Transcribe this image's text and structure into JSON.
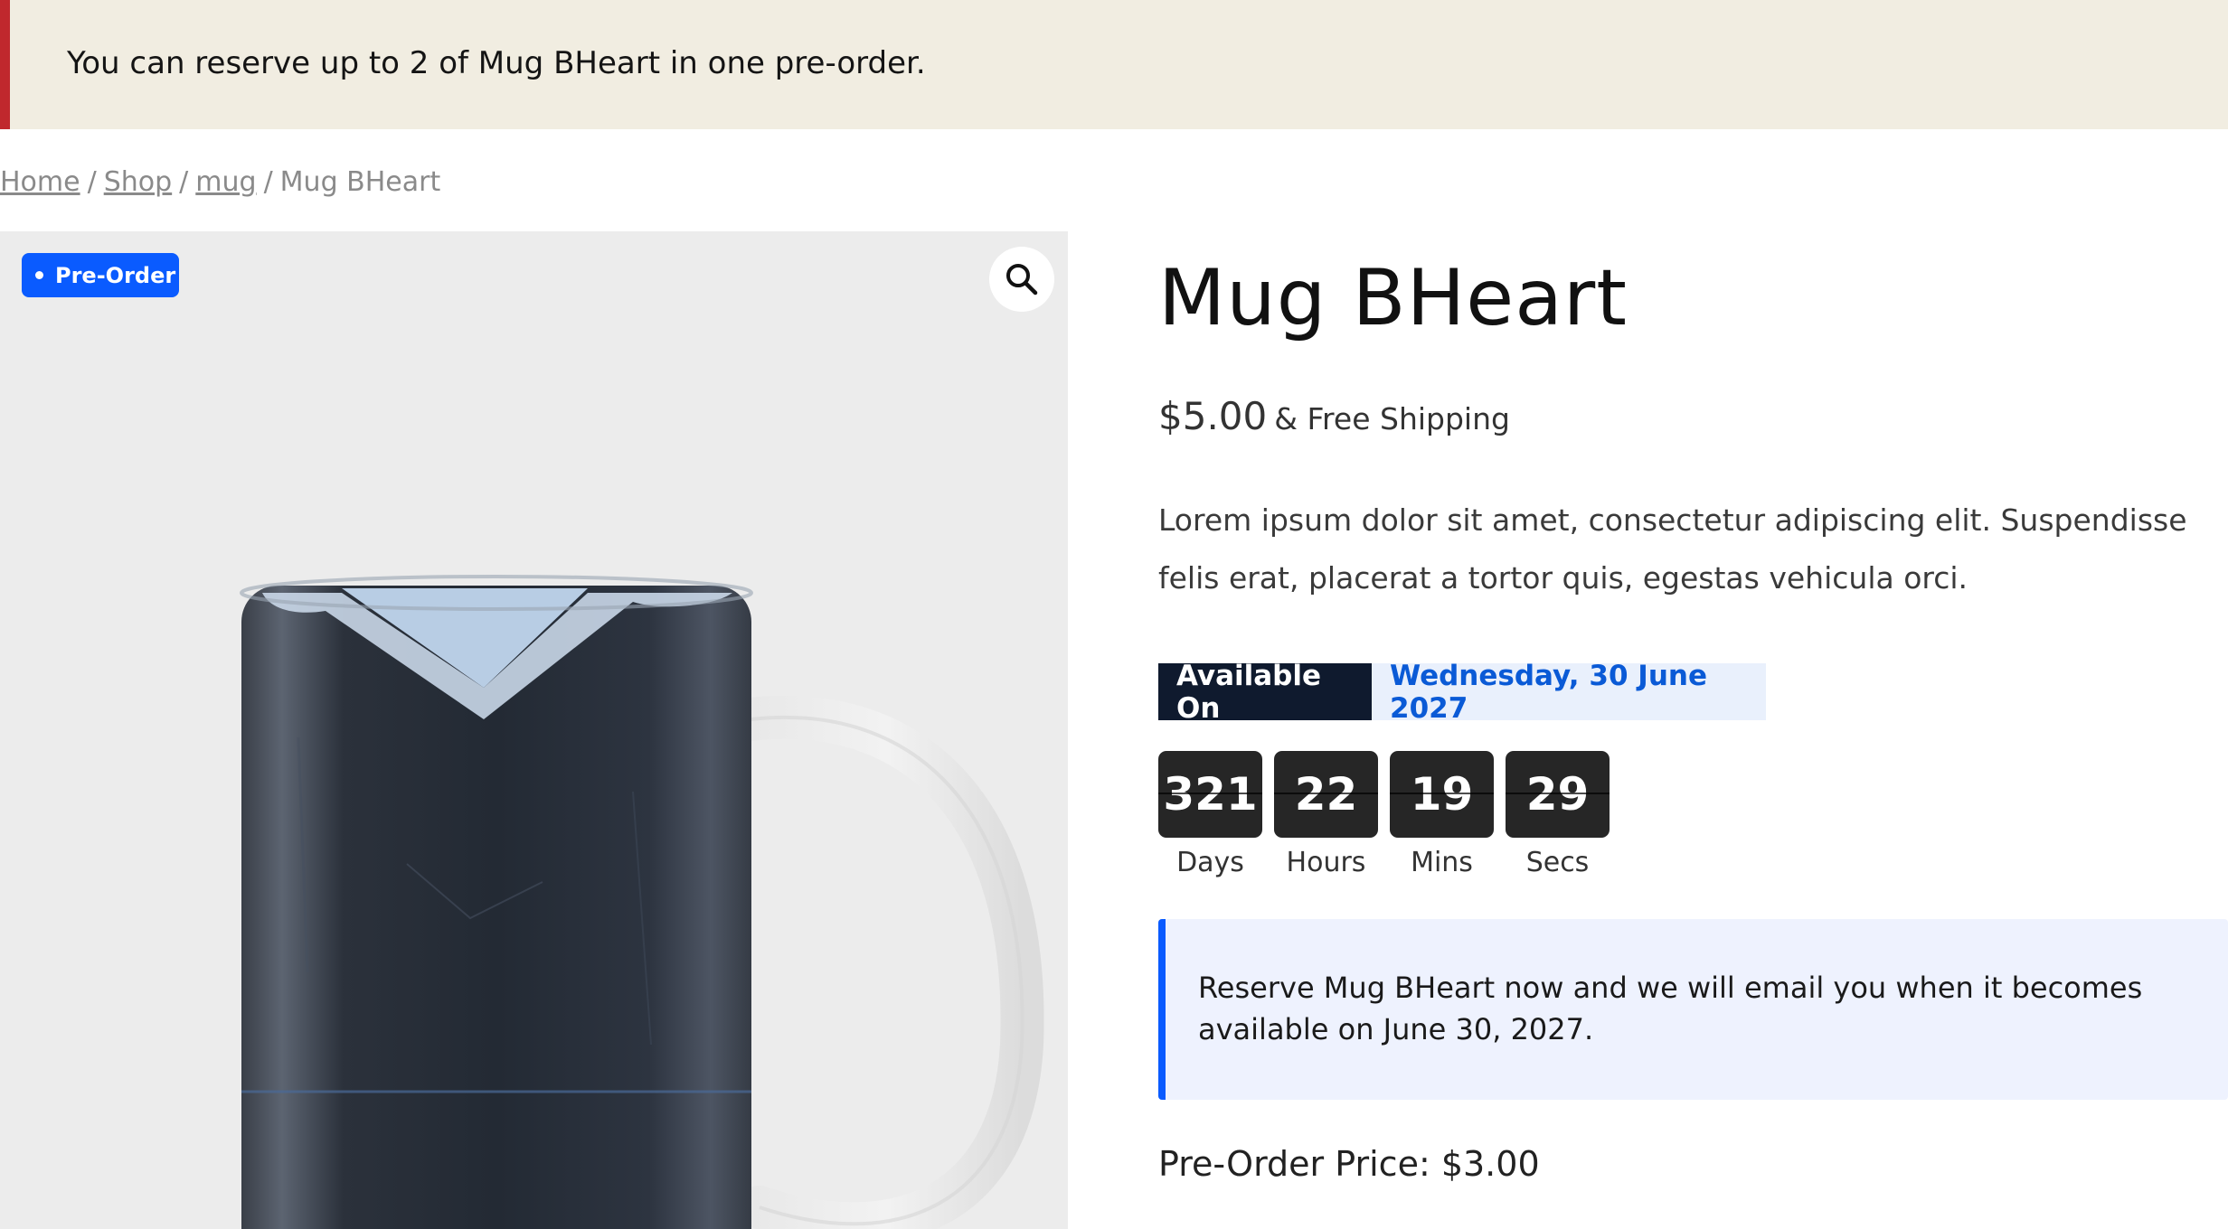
{
  "notice": {
    "message": "You can reserve up to 2 of Mug BHeart in one pre-order.",
    "accent_color": "#c0282d"
  },
  "breadcrumb": {
    "items": [
      "Home",
      "Shop",
      "mug"
    ],
    "current": "Mug BHeart",
    "separator": "/"
  },
  "gallery": {
    "badge_label": "Pre-Order",
    "badge_color": "#0a5bff",
    "zoom_icon": "magnifier-icon"
  },
  "product": {
    "title": "Mug BHeart",
    "price": "$5.00",
    "shipping": "& Free Shipping",
    "description": "Lorem ipsum dolor sit amet, consectetur adipiscing elit. Suspendisse felis erat, placerat a tortor quis, egestas vehicula orci."
  },
  "availability": {
    "label": "Available On",
    "date": "Wednesday, 30 June 2027"
  },
  "countdown": [
    {
      "value": "321",
      "label": "Days"
    },
    {
      "value": "22",
      "label": "Hours"
    },
    {
      "value": "19",
      "label": "Mins"
    },
    {
      "value": "29",
      "label": "Secs"
    }
  ],
  "reserve_note": "Reserve Mug BHeart now and we will email you when it becomes available on June 30, 2027.",
  "preorder_price": "Pre-Order Price: $3.00"
}
